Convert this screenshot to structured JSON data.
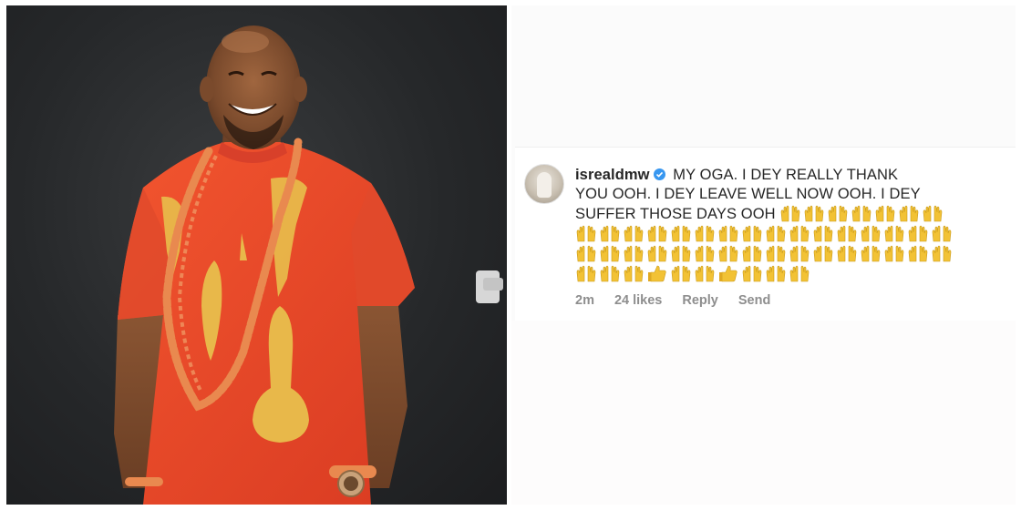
{
  "comment": {
    "username": "isrealdmw",
    "text_line1": "MY OGA. I DEY REALLY THANK",
    "text_line2": "YOU OOH. I DEY LEAVE WELL NOW OOH. I DEY",
    "text_line3": "SUFFER THOSE DAYS OOH",
    "emoji_name": "raising-hands-emoji",
    "thumbs_emoji_name": "thumbs-up-emoji",
    "time": "2m",
    "likes": "24 likes",
    "reply_label": "Reply",
    "send_label": "Send"
  },
  "colors": {
    "outfit": "#e8462a",
    "embroidery": "#e8b84a",
    "beads": "#e9894f",
    "verified": "#3897f0",
    "meta_text": "#8e8e8e",
    "emoji": "#f2c235"
  }
}
